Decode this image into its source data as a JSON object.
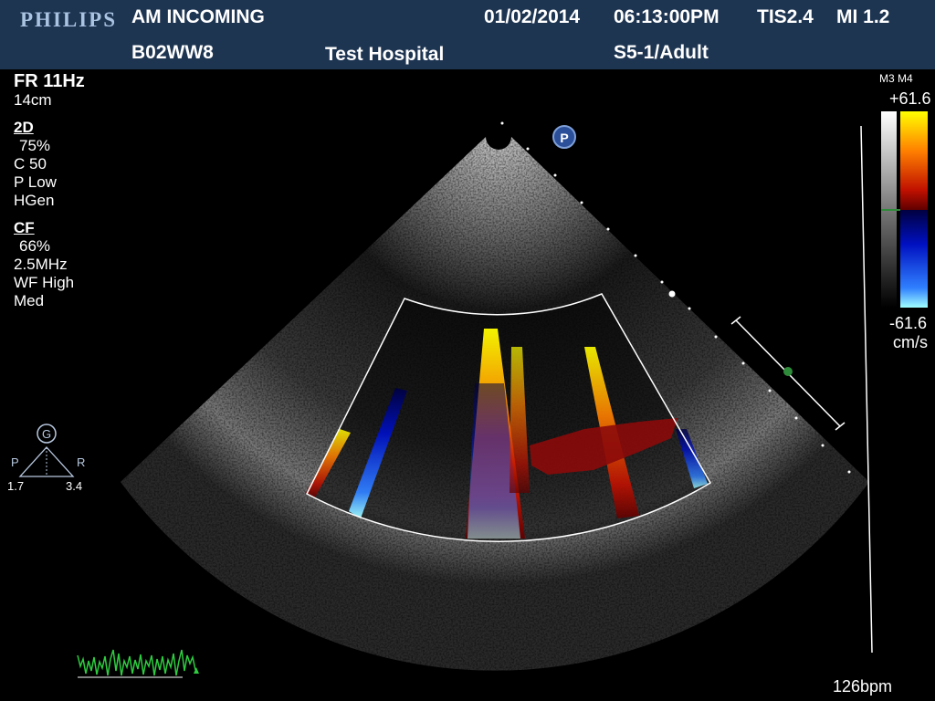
{
  "header": {
    "brand": "PHILIPS",
    "patient_status": "AM INCOMING",
    "patient_id": "B02WW8",
    "hospital": "Test Hospital",
    "date": "01/02/2014",
    "time": "06:13:00PM",
    "tis": "TIS2.4",
    "mi": "MI 1.2",
    "probe_preset": "S5-1/Adult"
  },
  "params": {
    "frame_rate": "FR 11Hz",
    "depth": "14cm",
    "mode_2d": {
      "heading": "2D",
      "gain": "75%",
      "compression": "C 50",
      "persistence": "P Low",
      "harmonic": "HGen"
    },
    "mode_cf": {
      "heading": "CF",
      "gain": "66%",
      "frequency": "2.5MHz",
      "wall_filter": "WF High",
      "sensitivity": "Med"
    }
  },
  "color_scale": {
    "mode": "M3 M4",
    "max": "+61.6",
    "min": "-61.6",
    "unit": "cm/s"
  },
  "focus": {
    "badge": "G",
    "left_label": "P",
    "right_label": "R",
    "left_value": "1.7",
    "right_value": "3.4"
  },
  "orientation_marker": "P",
  "heart_rate": "126bpm"
}
